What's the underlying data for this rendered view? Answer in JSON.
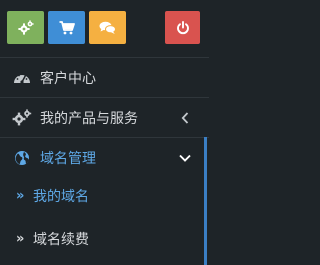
{
  "quick_actions": [
    {
      "icon": "gears-icon",
      "color": "#7fb15d"
    },
    {
      "icon": "cart-icon",
      "color": "#3f8ed6"
    },
    {
      "icon": "chat-icon",
      "color": "#f5b041"
    },
    {
      "icon": "power-icon",
      "color": "#d9534f"
    }
  ],
  "menu": {
    "customer_center": "客户中心",
    "products_services": "我的产品与服务",
    "domain_management": "域名管理"
  },
  "submenu": {
    "my_domains": "我的域名",
    "domain_renewal": "域名续费",
    "bullet": "»"
  },
  "colors": {
    "background": "#1e2428",
    "text": "#d6d9dc",
    "accent": "#5ea8e6",
    "icon": "#c3c8cc"
  }
}
